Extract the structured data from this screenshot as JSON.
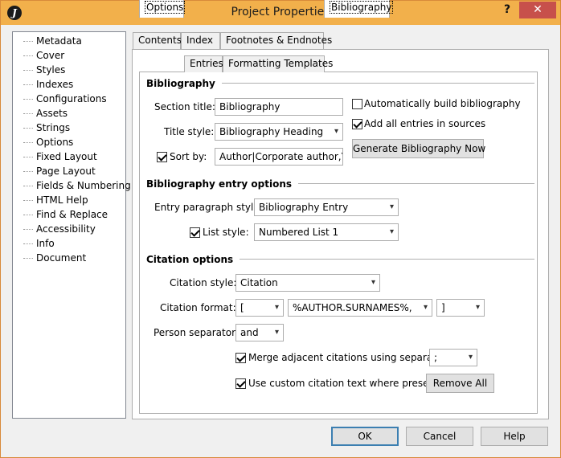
{
  "window": {
    "title": "Project Properties",
    "help_glyph": "?",
    "close_glyph": "✕",
    "app_icon": "J"
  },
  "tree": {
    "items": [
      "Metadata",
      "Cover",
      "Styles",
      "Indexes",
      "Configurations",
      "Assets",
      "Strings",
      "Options",
      "Fixed Layout",
      "Page Layout",
      "Fields & Numbering",
      "HTML Help",
      "Find & Replace",
      "Accessibility",
      "Info",
      "Document"
    ]
  },
  "tabs": [
    "Contents",
    "Index",
    "Footnotes & Endnotes",
    "Bibliography"
  ],
  "subtabs": [
    "Options",
    "Entries",
    "Formatting Templates"
  ],
  "sections": {
    "bibliography": "Bibliography",
    "entry_options": "Bibliography entry options",
    "citation_options": "Citation options"
  },
  "bibliography": {
    "section_title_label": "Section title:",
    "section_title_value": "Bibliography",
    "title_style_label": "Title style:",
    "title_style_value": "Bibliography Heading",
    "sort_by_label": "Sort by:",
    "sort_by_value": "Author|Corporate author,Year|Title",
    "auto_build_label": "Automatically build bibliography",
    "add_all_label": "Add all entries in sources",
    "generate_button": "Generate Bibliography Now"
  },
  "entry_options": {
    "entry_style_label": "Entry paragraph style:",
    "entry_style_value": "Bibliography Entry",
    "list_style_label": "List style:",
    "list_style_value": "Numbered List 1"
  },
  "citation": {
    "style_label": "Citation style:",
    "style_value": "Citation",
    "format_label": "Citation format:",
    "format_open": "[",
    "format_template": "%AUTHOR.SURNAMES%, %YEAR%",
    "format_close": "]",
    "person_sep_label": "Person separator:",
    "person_sep_value": "and",
    "merge_label": "Merge adjacent citations using separator",
    "merge_sep_value": ";",
    "custom_text_label": "Use custom citation text where present",
    "remove_all_button": "Remove All"
  },
  "footer": {
    "ok": "OK",
    "cancel": "Cancel",
    "help": "Help"
  }
}
